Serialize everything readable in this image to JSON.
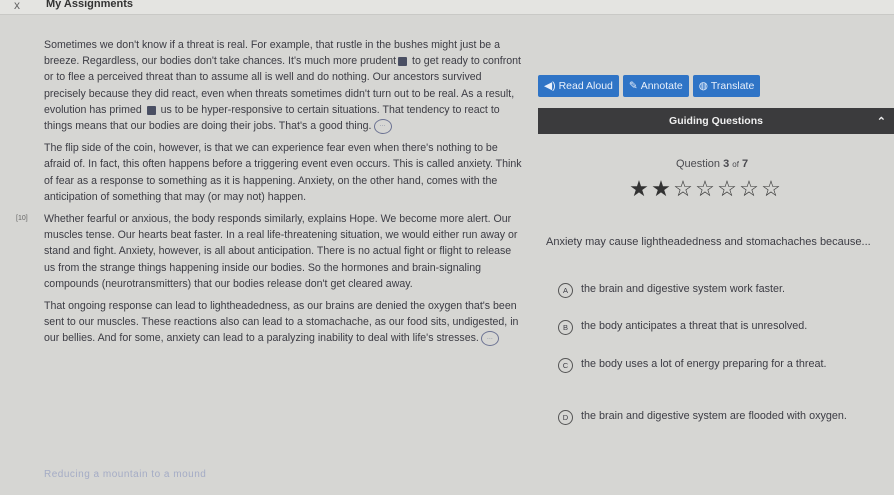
{
  "window": {
    "close": "x",
    "title": "My Assignments"
  },
  "reading": {
    "p1_a": "Sometimes we don't know if a threat is real. For example, that rustle in the bushes might just be a breeze. Regardless, our bodies don't take chances. It's much more prudent",
    "p1_b": " to get ready to confront or to flee a perceived threat than to assume all is well and do nothing. Our ancestors survived precisely because they did react, even when threats sometimes didn't turn out to be real. As a result, evolution has primed",
    "p1_c": " us to be hyper-responsive to certain situations. That tendency to react to things means that our bodies are doing their jobs. That's a good thing.",
    "p2": "The flip side of the coin, however, is that we can experience fear even when there's nothing to be afraid of. In fact, this often happens before a triggering event even occurs. This is called anxiety. Think of fear as a response to something as it is happening. Anxiety, on the other hand, comes with the anticipation of something that may (or may not) happen.",
    "p3_num": "[10]",
    "p3": "Whether fearful or anxious, the body responds similarly, explains Hope. We become more alert. Our muscles tense. Our hearts beat faster. In a real life-threatening situation, we would either run away or stand and fight. Anxiety, however, is all about anticipation. There is no actual fight or flight to release us from the strange things happening inside our bodies. So the hormones and brain-signaling compounds (neurotransmitters) that our bodies release don't get cleared away.",
    "p4": "That ongoing response can lead to lightheadedness, as our brains are denied the oxygen that's been sent to our muscles. These reactions also can lead to a stomachache, as our food sits, undigested, in our bellies. And for some, anxiety can lead to a paralyzing inability to deal with life's stresses.",
    "faded_heading": "Reducing a mountain to a mound"
  },
  "toolbar": {
    "read_aloud": "Read Aloud",
    "annotate": "Annotate",
    "translate": "Translate"
  },
  "guiding": {
    "title": "Guiding Questions"
  },
  "question": {
    "label": "Question",
    "number": "3",
    "of": "of",
    "total": "7",
    "rating": 2,
    "rating_max": 7,
    "stem": "Anxiety may cause lightheadedness and stomachaches because...",
    "options": [
      {
        "letter": "A",
        "text": "the brain and digestive system work faster."
      },
      {
        "letter": "B",
        "text": "the body anticipates a threat that is unresolved."
      },
      {
        "letter": "C",
        "text": "the body uses a lot of energy preparing for a threat."
      },
      {
        "letter": "D",
        "text": "the brain and digestive system are flooded with oxygen."
      }
    ]
  },
  "colors": {
    "accent": "#2f74c6",
    "header_dark": "#3b3b3d"
  }
}
